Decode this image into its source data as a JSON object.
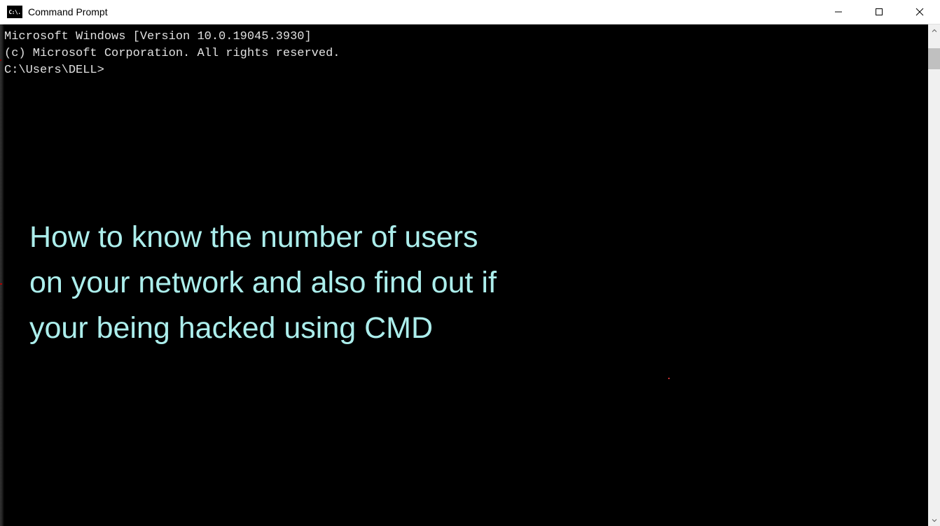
{
  "window": {
    "title": "Command Prompt",
    "icon_text": "C:\\."
  },
  "terminal": {
    "line1": "Microsoft Windows [Version 10.0.19045.3930]",
    "line2": "(c) Microsoft Corporation. All rights reserved.",
    "blank": "",
    "prompt": "C:\\Users\\DELL>"
  },
  "overlay": {
    "text": "How to know the number of users on your network and also find out if your being hacked using CMD"
  }
}
